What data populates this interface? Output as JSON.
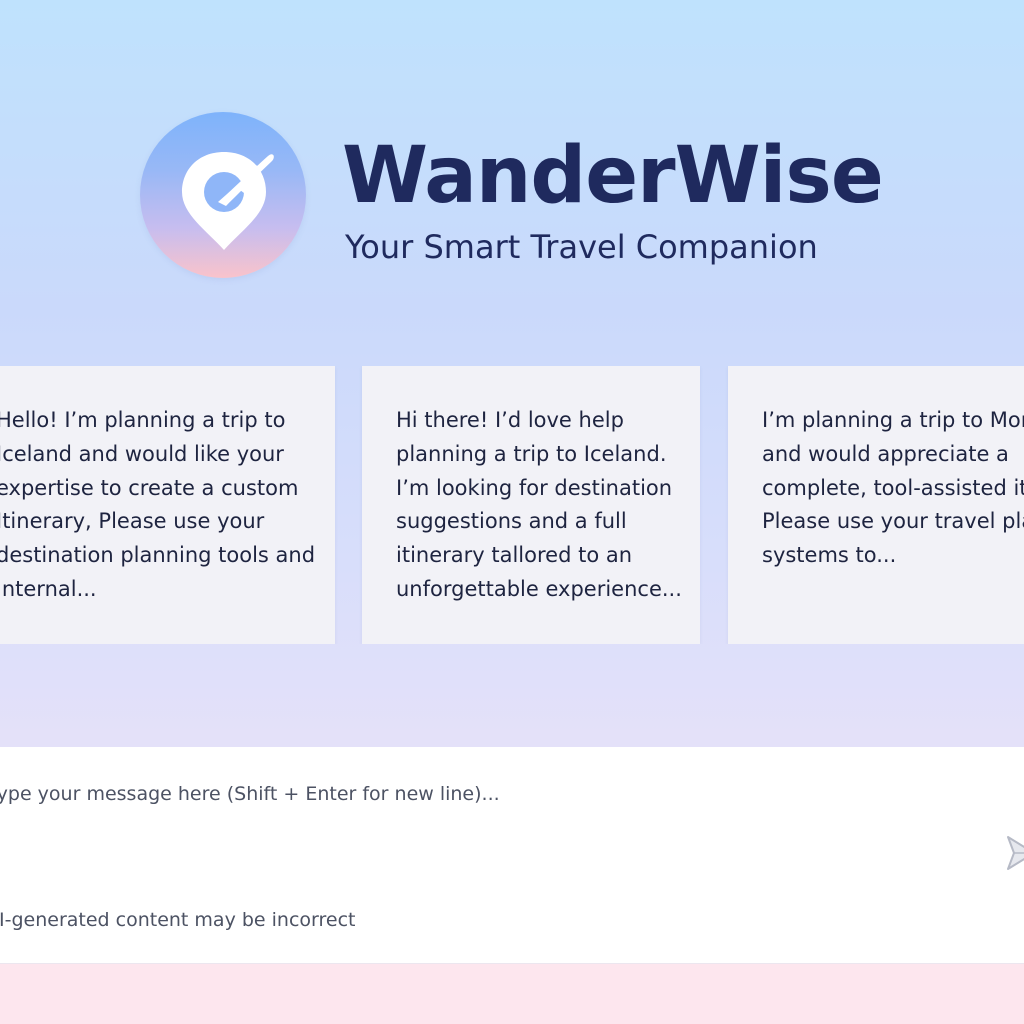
{
  "app": {
    "name": "WanderWise",
    "tagline": "Your Smart Travel Companion",
    "logo_icon": "map-pin-airplane-icon"
  },
  "suggestions": [
    {
      "text": "Hello! I’m planning a trip to\nIceland and would like your\nexpertise to create a custom\nItinerary, Please use your\ndestination planning tools and\ninternal..."
    },
    {
      "text": "Hi there! I’d love help\nplanning a trip to Iceland.\nI’m looking for destination\nsuggestions and a full\nitinerary tallored to an\nunforgettable experience..."
    },
    {
      "text": "I’m planning a trip to Moro...\nand would appreciate a\ncomplete, tool-assisted itine...\nPlease use your travel planni...\nsystems to..."
    }
  ],
  "composer": {
    "placeholder": "Type your message here (Shift + Enter for new line)...",
    "value": "",
    "send_icon": "paper-plane-send-icon",
    "disclaimer": "AI-generated content may be incorrect"
  },
  "colors": {
    "brand_text": "#1f2a5e",
    "card_background": "#f2f2f7",
    "background_top": "#bfe2fd",
    "background_bottom": "#ece4f7",
    "footer_band": "#fde6ee"
  }
}
